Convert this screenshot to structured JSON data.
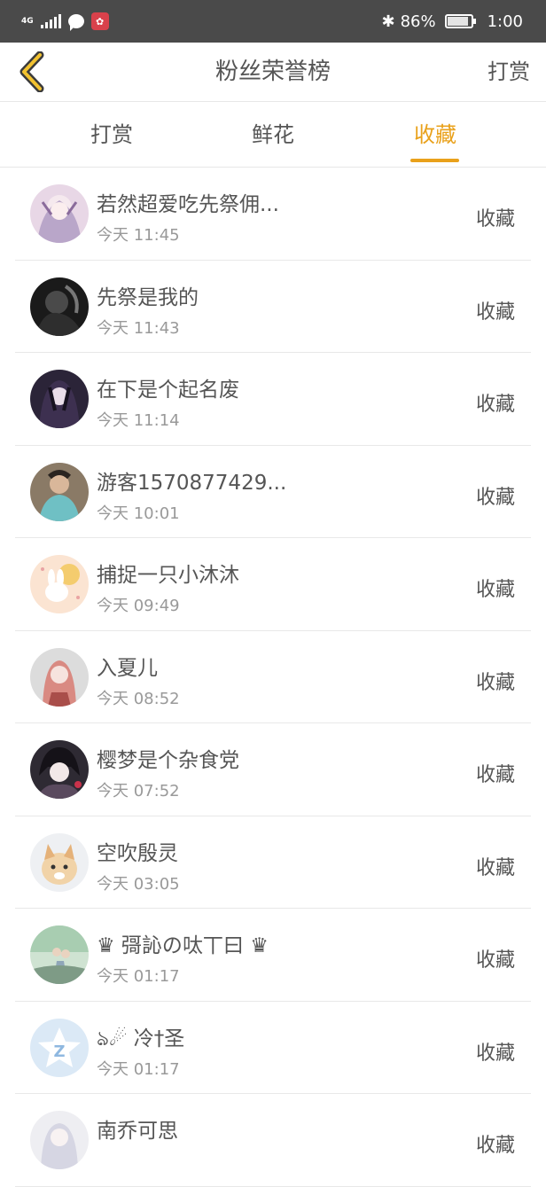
{
  "statusbar": {
    "network": "4G",
    "battery": "86%",
    "time": "1:00"
  },
  "navbar": {
    "title": "粉丝荣誉榜",
    "right_action": "打赏"
  },
  "tabs": [
    {
      "label": "打赏"
    },
    {
      "label": "鲜花"
    },
    {
      "label": "收藏"
    }
  ],
  "active_tab": "收藏",
  "colors": {
    "accent": "#e9a11b",
    "status_bar": "#4a4a4a",
    "divider": "#e8e8e8"
  },
  "fans": [
    {
      "name": "若然超爱吃先祭佣...",
      "time": "今天 11:45",
      "action": "收藏"
    },
    {
      "name": "先祭是我的",
      "time": "今天 11:43",
      "action": "收藏"
    },
    {
      "name": "在下是个起名废",
      "time": "今天 11:14",
      "action": "收藏"
    },
    {
      "name": "游客1570877429...",
      "time": "今天 10:01",
      "action": "收藏"
    },
    {
      "name": "捕捉一只小沐沐",
      "time": "今天 09:49",
      "action": "收藏"
    },
    {
      "name": "入夏儿",
      "time": "今天 08:52",
      "action": "收藏"
    },
    {
      "name": "樱梦是个杂食党",
      "time": "今天 07:52",
      "action": "收藏"
    },
    {
      "name": "空吹殷灵",
      "time": "今天 03:05",
      "action": "收藏"
    },
    {
      "name": "♛ 彁訫の呔丅曰 ♛",
      "time": "今天 01:17",
      "action": "收藏"
    },
    {
      "name": "ঌ☄ 冷†圣",
      "time": "今天 01:17",
      "action": "收藏"
    },
    {
      "name": "南乔可思",
      "time": "",
      "action": "收藏"
    }
  ]
}
